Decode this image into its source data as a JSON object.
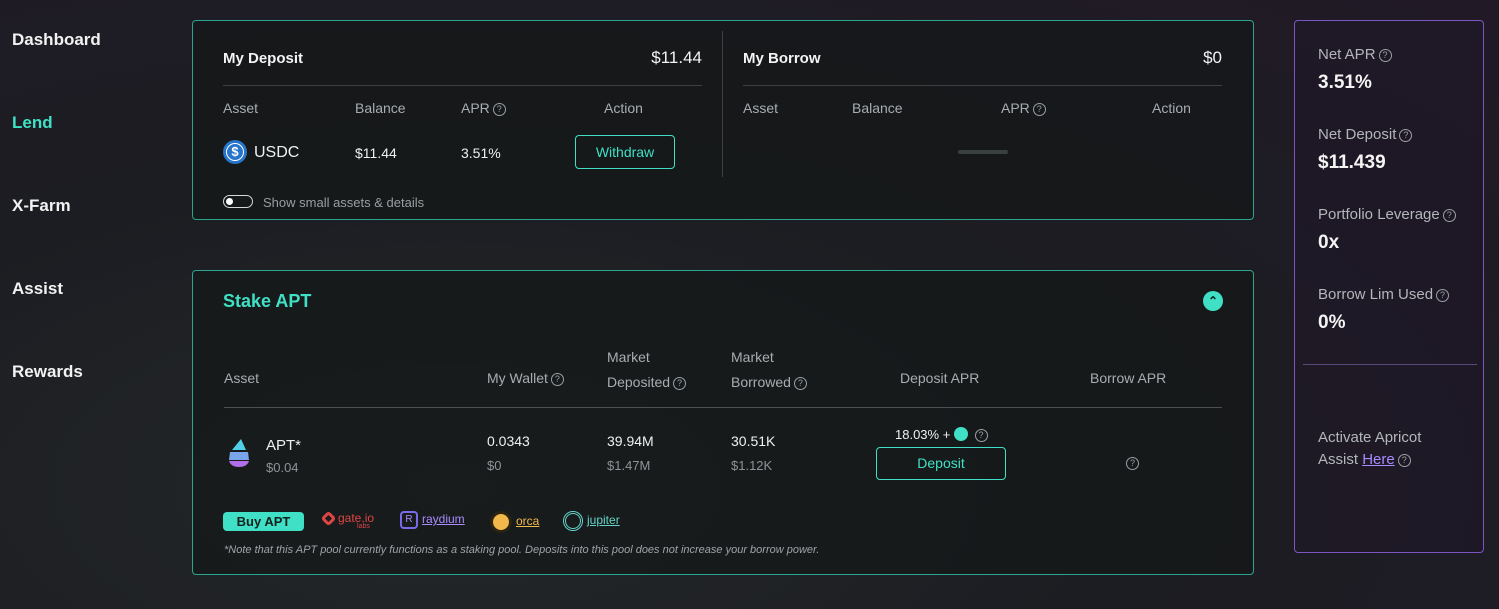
{
  "nav": {
    "items": [
      "Dashboard",
      "Lend",
      "X-Farm",
      "Assist",
      "Rewards"
    ],
    "active": "Lend"
  },
  "deposit": {
    "title": "My Deposit",
    "total": "$11.44",
    "columns": [
      "Asset",
      "Balance",
      "APR",
      "Action"
    ],
    "row": {
      "asset": "USDC",
      "balance": "$11.44",
      "apr": "3.51%",
      "action": "Withdraw"
    },
    "toggle_label": "Show small assets & details"
  },
  "borrow": {
    "title": "My Borrow",
    "total": "$0",
    "columns": [
      "Asset",
      "Balance",
      "APR",
      "Action"
    ]
  },
  "stake": {
    "title": "Stake APT",
    "columns": {
      "asset": "Asset",
      "wallet": "My Wallet",
      "deposited_top": "Market",
      "deposited_bottom": "Deposited",
      "borrowed_top": "Market",
      "borrowed_bottom": "Borrowed",
      "deposit_apr": "Deposit APR",
      "borrow_apr": "Borrow APR"
    },
    "row": {
      "asset": "APT*",
      "asset_value": "$0.04",
      "wallet": "0.0343",
      "wallet_usd": "$0",
      "deposited": "39.94M",
      "deposited_usd": "$1.47M",
      "borrowed": "30.51K",
      "borrowed_usd": "$1.12K",
      "deposit_apr": "18.03% +",
      "action": "Deposit"
    },
    "buy_label": "Buy APT",
    "partners": [
      "gate.io",
      "raydium",
      "orca",
      "jupiter"
    ],
    "partner_sub": "labs",
    "note": "*Note that this APT pool currently functions as a staking pool. Deposits into this pool does not increase your borrow power."
  },
  "summary": {
    "net_apr_label": "Net APR",
    "net_apr": "3.51%",
    "net_deposit_label": "Net Deposit",
    "net_deposit": "$11.439",
    "leverage_label": "Portfolio Leverage",
    "leverage": "0x",
    "borrow_lim_label": "Borrow Lim Used",
    "borrow_lim": "0%",
    "assist_text_1": "Activate Apricot",
    "assist_text_2": "Assist",
    "assist_link": "Here"
  },
  "colors": {
    "accent": "#3fe0c5",
    "purple": "#7b56c2",
    "usdc": "#2775ca"
  }
}
